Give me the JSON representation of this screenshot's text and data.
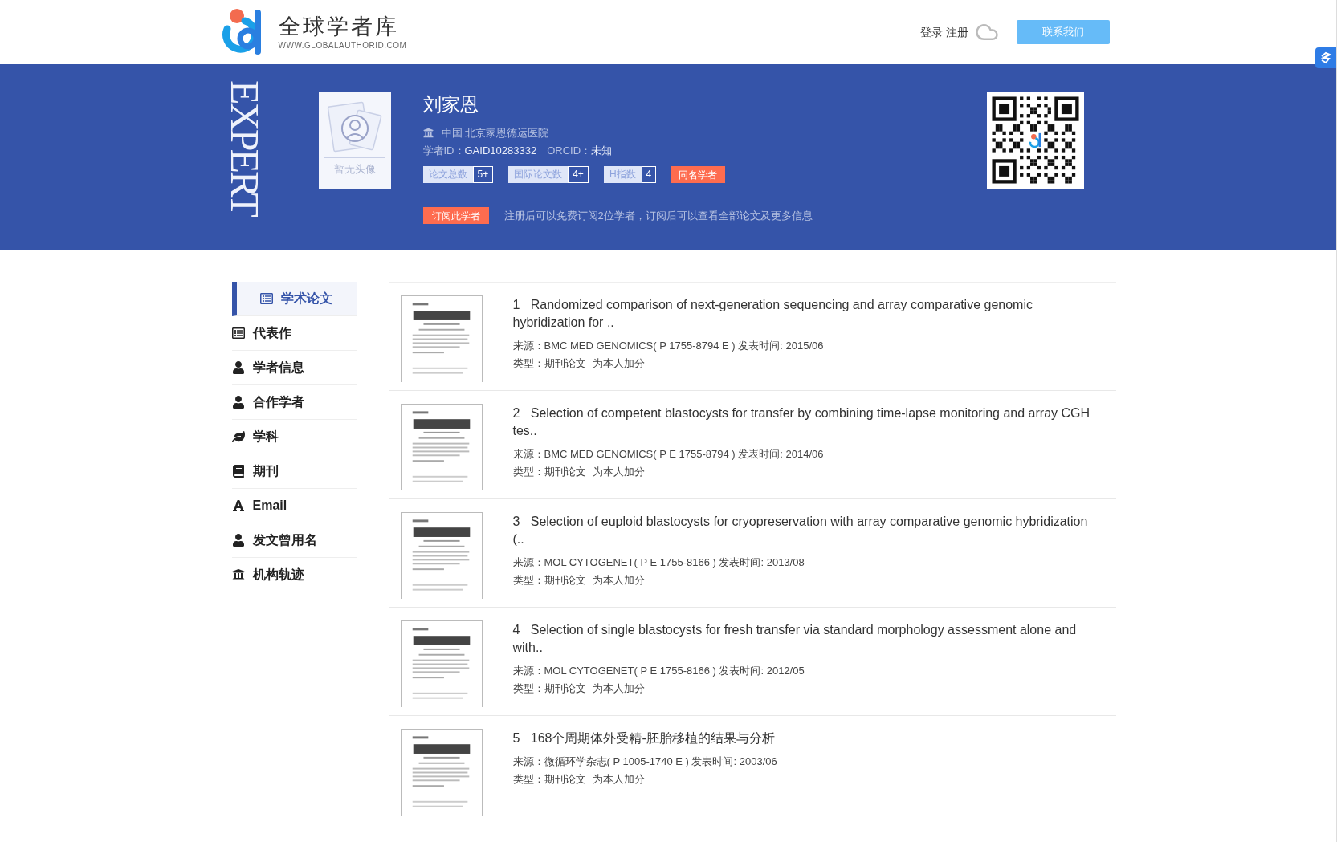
{
  "header": {
    "logo_title": "全球学者库",
    "logo_subtitle": "WWW.GLOBALAUTHORID.COM",
    "login": "登录",
    "register": "注册",
    "contact": "联系我们"
  },
  "banner": {
    "side_text": "EXPERT",
    "avatar_caption": "暂无头像",
    "name": "刘家恩",
    "institution": "中国 北京家恩德运医院",
    "id_label": "学者ID：",
    "id": "GAID10283332",
    "orcid_label": "ORCID：",
    "orcid": "未知",
    "stats": [
      {
        "label": "论文总数",
        "value": "5+"
      },
      {
        "label": "国际论文数",
        "value": "4+"
      },
      {
        "label": "H指数",
        "value": "4"
      }
    ],
    "same_name": "同名学者",
    "subscribe": "订阅此学者",
    "note": "注册后可以免费订阅2位学者，订阅后可以查看全部论文及更多信息"
  },
  "sidebar": {
    "items": [
      {
        "kind": "list",
        "label": "学术论文",
        "selected": true
      },
      {
        "kind": "list",
        "label": "代表作",
        "selected": false
      },
      {
        "kind": "user",
        "label": "学者信息",
        "selected": false
      },
      {
        "kind": "user",
        "label": "合作学者",
        "selected": false
      },
      {
        "kind": "leaf",
        "label": "学科",
        "selected": false
      },
      {
        "kind": "book",
        "label": "期刊",
        "selected": false
      },
      {
        "kind": "font",
        "label": "Email",
        "selected": false
      },
      {
        "kind": "user",
        "label": "发文曾用名",
        "selected": false
      },
      {
        "kind": "bank",
        "label": "机构轨迹",
        "selected": false
      }
    ]
  },
  "papers": [
    {
      "number": "1",
      "title": "Randomized comparison of next-generation sequencing and array comparative genomic hybridization for ..",
      "source": "来源：BMC MED GENOMICS( P 1755-8794 E ) 发表时间: 2015/06",
      "type": "类型：期刊论文",
      "bonus": "为本人加分"
    },
    {
      "number": "2",
      "title": "Selection of competent blastocysts for transfer by combining time-lapse monitoring and array CGH tes..",
      "source": "来源：BMC MED GENOMICS( P E 1755-8794 ) 发表时间: 2014/06",
      "type": "类型：期刊论文",
      "bonus": "为本人加分"
    },
    {
      "number": "3",
      "title": "Selection of euploid blastocysts for cryopreservation with array comparative genomic hybridization (..",
      "source": "来源：MOL CYTOGENET( P E 1755-8166 ) 发表时间: 2013/08",
      "type": "类型：期刊论文",
      "bonus": "为本人加分"
    },
    {
      "number": "4",
      "title": "Selection of single blastocysts for fresh transfer via standard morphology assessment alone and with..",
      "source": "来源：MOL CYTOGENET( P E 1755-8166 ) 发表时间: 2012/05",
      "type": "类型：期刊论文",
      "bonus": "为本人加分"
    },
    {
      "number": "5",
      "title": "168个周期体外受精-胚胎移植的结果与分析",
      "source": "来源：微循环学杂志( P 1005-1740 E ) 发表时间: 2003/06",
      "type": "类型：期刊论文",
      "bonus": "为本人加分"
    }
  ]
}
